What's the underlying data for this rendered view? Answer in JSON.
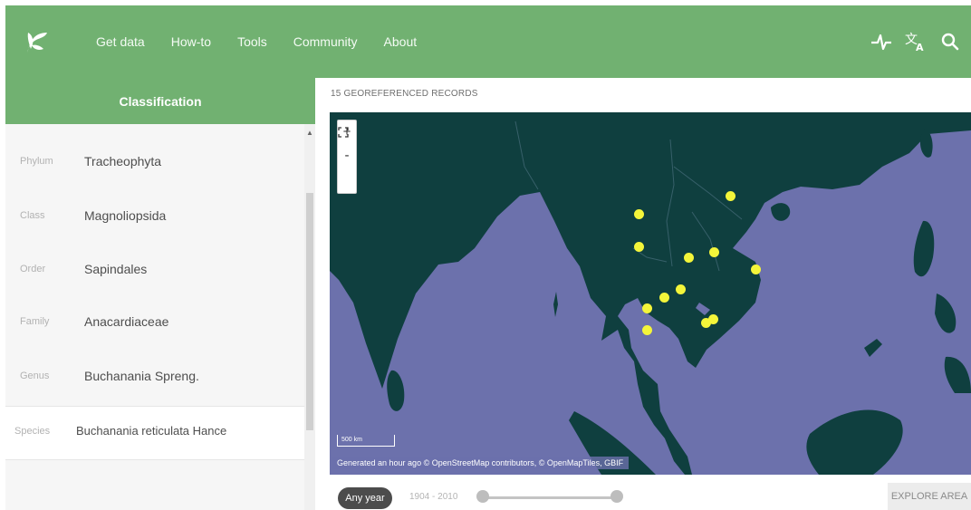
{
  "header": {
    "logo_icon": "gbif-leaf-logo-icon",
    "nav": [
      "Get data",
      "How-to",
      "Tools",
      "Community",
      "About"
    ],
    "tool_icons": [
      "health-pulse-icon",
      "translate-icon",
      "search-icon"
    ]
  },
  "sidebar": {
    "title": "Classification",
    "taxonomy": [
      {
        "rank": "Phylum",
        "name": "Tracheophyta"
      },
      {
        "rank": "Class",
        "name": "Magnoliopsida"
      },
      {
        "rank": "Order",
        "name": "Sapindales"
      },
      {
        "rank": "Family",
        "name": "Anacardiaceae"
      },
      {
        "rank": "Genus",
        "name": "Buchanania Spreng."
      },
      {
        "rank": "Species",
        "name": "Buchanania reticulata Hance"
      }
    ]
  },
  "map": {
    "records_label": "15 GEOREFERENCED RECORDS",
    "zoom_in": "+",
    "zoom_out": "-",
    "fullscreen_icon": "fullscreen-icon",
    "scale": "500 km",
    "attribution": "Generated an hour ago © OpenStreetMap contributors, © OpenMapTiles, GBIF",
    "colors": {
      "water": "#6c71ac",
      "land": "#0f3f3f",
      "occurrence": "#f4f53a"
    }
  },
  "controls": {
    "year_filter": "Any year",
    "year_range": "1904 - 2010",
    "explore_button": "EXPLORE AREA"
  }
}
